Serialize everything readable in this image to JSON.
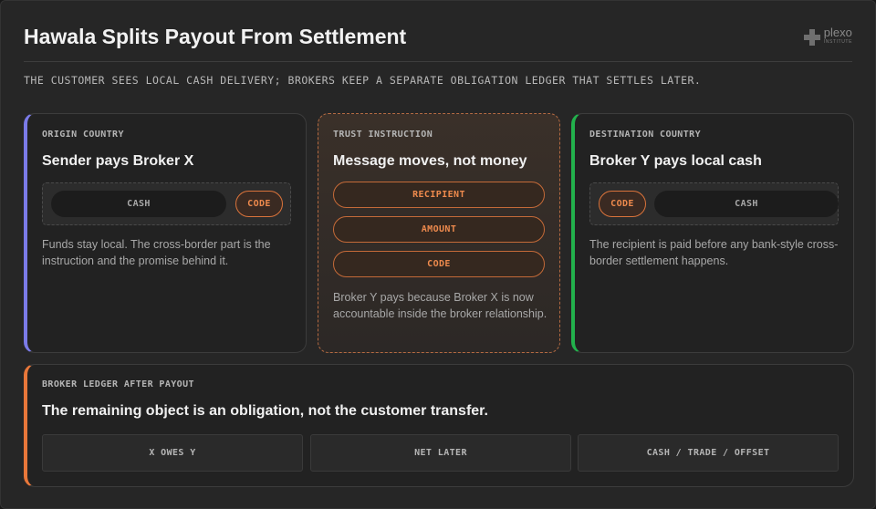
{
  "header": {
    "title": "Hawala Splits Payout From Settlement",
    "subtitle": "THE CUSTOMER SEES LOCAL CASH DELIVERY; BROKERS KEEP A SEPARATE OBLIGATION LEDGER THAT SETTLES LATER.",
    "logo_name": "plexo",
    "logo_sub": "INSTITUTE"
  },
  "colors": {
    "origin_accent": "#7b7be8",
    "trust_accent": "#e8773a",
    "destination_accent": "#22b14c",
    "ledger_accent": "#e8773a"
  },
  "origin": {
    "eyebrow": "ORIGIN COUNTRY",
    "title": "Sender pays Broker X",
    "token_cash": "CASH",
    "token_code": "CODE",
    "body": "Funds stay local. The cross-border part is the instruction and the promise behind it."
  },
  "trust": {
    "eyebrow": "TRUST INSTRUCTION",
    "title": "Message moves, not money",
    "items": [
      "RECIPIENT",
      "AMOUNT",
      "CODE"
    ],
    "body": "Broker Y pays because Broker X is now accountable inside the broker relationship."
  },
  "destination": {
    "eyebrow": "DESTINATION COUNTRY",
    "title": "Broker Y pays local cash",
    "token_code": "CODE",
    "token_cash": "CASH",
    "body": "The recipient is paid before any bank-style cross-border settlement happens."
  },
  "ledger": {
    "eyebrow": "BROKER LEDGER AFTER PAYOUT",
    "title": "The remaining object is an obligation, not the customer transfer.",
    "items": [
      "X OWES Y",
      "NET LATER",
      "CASH / TRADE / OFFSET"
    ]
  }
}
